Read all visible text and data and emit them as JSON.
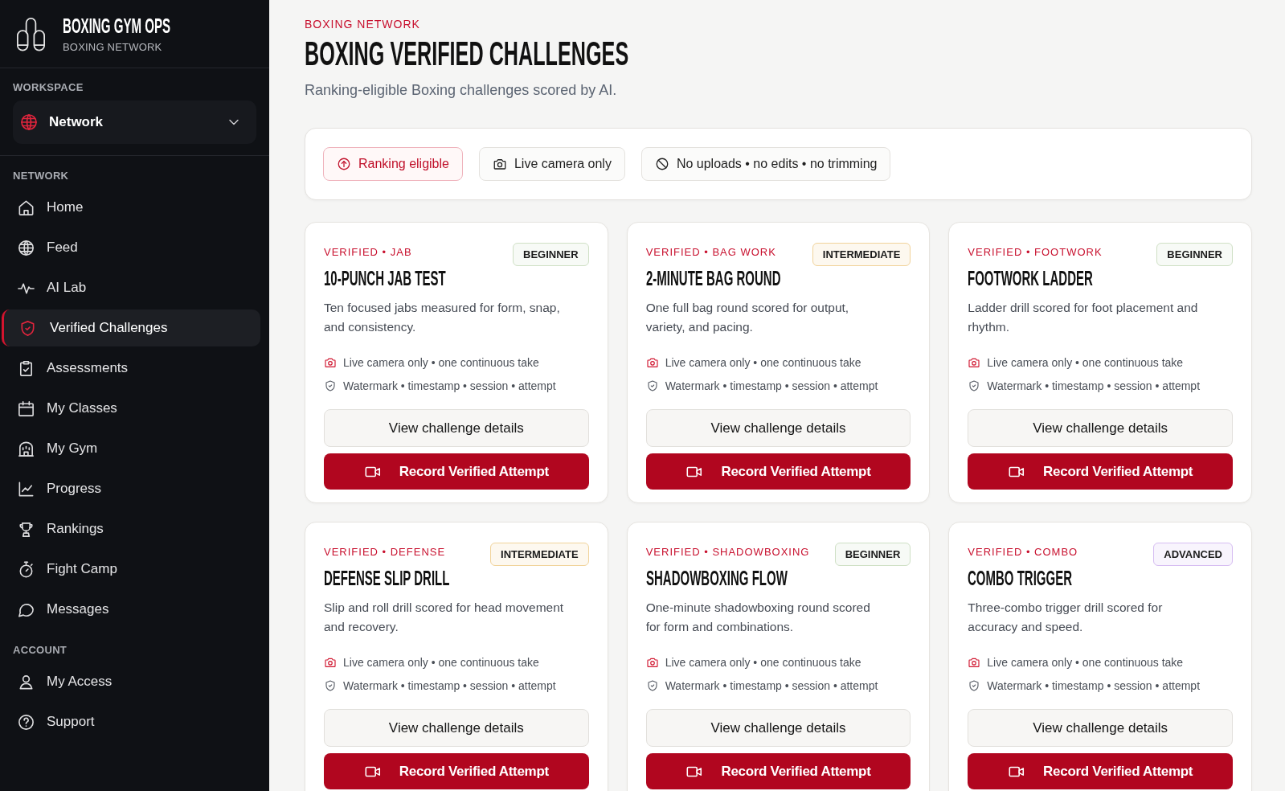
{
  "sidebar": {
    "brand": {
      "title": "BOXING GYM OPS",
      "subtitle": "BOXING NETWORK"
    },
    "workspace": {
      "label": "WORKSPACE",
      "value": "Network"
    },
    "sections": [
      {
        "label": "NETWORK",
        "items": [
          {
            "label": "Home",
            "selected": false
          },
          {
            "label": "Feed",
            "selected": false
          },
          {
            "label": "AI Lab",
            "selected": false
          },
          {
            "label": "Verified Challenges",
            "selected": true
          },
          {
            "label": "Assessments",
            "selected": false
          },
          {
            "label": "My Classes",
            "selected": false
          },
          {
            "label": "My Gym",
            "selected": false
          },
          {
            "label": "Progress",
            "selected": false
          },
          {
            "label": "Rankings",
            "selected": false
          },
          {
            "label": "Fight Camp",
            "selected": false
          },
          {
            "label": "Messages",
            "selected": false
          }
        ]
      },
      {
        "label": "ACCOUNT",
        "items": [
          {
            "label": "My Access",
            "selected": false
          },
          {
            "label": "Support",
            "selected": false
          }
        ]
      }
    ]
  },
  "header": {
    "eyebrow": "BOXING NETWORK",
    "title": "BOXING VERIFIED CHALLENGES",
    "subtitle": "Ranking-eligible Boxing challenges scored by AI."
  },
  "rules": [
    {
      "kind": "accent",
      "label": "Ranking eligible"
    },
    {
      "kind": "plain",
      "label": "Live camera only"
    },
    {
      "kind": "plain",
      "label": "No uploads • no edits • no trimming"
    }
  ],
  "cards": [
    {
      "category": "VERIFIED • JAB",
      "badge": {
        "label": "BEGINNER",
        "color": "#cfe0c5"
      },
      "title": "10-PUNCH JAB TEST",
      "description": "Ten focused jabs measured for form, snap, and consistency.",
      "requirements": [
        {
          "kind": "capture",
          "text": "Live camera only • one continuous take"
        },
        {
          "kind": "integrity",
          "text": "Watermark • timestamp • session • attempt"
        }
      ],
      "details_button": "View challenge details",
      "record_button": "Record Verified Attempt"
    },
    {
      "category": "VERIFIED • BAG WORK",
      "badge": {
        "label": "INTERMEDIATE",
        "color": "#f1d39a"
      },
      "title": "2-MINUTE BAG ROUND",
      "description": "One full bag round scored for output, variety, and pacing.",
      "requirements": [
        {
          "kind": "capture",
          "text": "Live camera only • one continuous take"
        },
        {
          "kind": "integrity",
          "text": "Watermark • timestamp • session • attempt"
        }
      ],
      "details_button": "View challenge details",
      "record_button": "Record Verified Attempt"
    },
    {
      "category": "VERIFIED • FOOTWORK",
      "badge": {
        "label": "BEGINNER",
        "color": "#cfe0c5"
      },
      "title": "FOOTWORK LADDER",
      "description": "Ladder drill scored for foot placement and rhythm.",
      "requirements": [
        {
          "kind": "capture",
          "text": "Live camera only • one continuous take"
        },
        {
          "kind": "integrity",
          "text": "Watermark • timestamp • session • attempt"
        }
      ],
      "details_button": "View challenge details",
      "record_button": "Record Verified Attempt"
    },
    {
      "category": "VERIFIED • DEFENSE",
      "badge": {
        "label": "INTERMEDIATE",
        "color": "#f1d39a"
      },
      "title": "DEFENSE SLIP DRILL",
      "description": "Slip and roll drill scored for head movement and recovery.",
      "requirements": [
        {
          "kind": "capture",
          "text": "Live camera only • one continuous take"
        },
        {
          "kind": "integrity",
          "text": "Watermark • timestamp • session • attempt"
        }
      ],
      "details_button": "View challenge details",
      "record_button": "Record Verified Attempt"
    },
    {
      "category": "VERIFIED • SHADOWBOXING",
      "badge": {
        "label": "BEGINNER",
        "color": "#cfe0c5"
      },
      "title": "SHADOWBOXING FLOW",
      "description": "One-minute shadowboxing round scored for form and combinations.",
      "requirements": [
        {
          "kind": "capture",
          "text": "Live camera only • one continuous take"
        },
        {
          "kind": "integrity",
          "text": "Watermark • timestamp • session • attempt"
        }
      ],
      "details_button": "View challenge details",
      "record_button": "Record Verified Attempt"
    },
    {
      "category": "VERIFIED • COMBO",
      "badge": {
        "label": "ADVANCED",
        "color": "#d6bdf2"
      },
      "title": "COMBO TRIGGER",
      "description": "Three-combo trigger drill scored for accuracy and speed.",
      "requirements": [
        {
          "kind": "capture",
          "text": "Live camera only • one continuous take"
        },
        {
          "kind": "integrity",
          "text": "Watermark • timestamp • session • attempt"
        }
      ],
      "details_button": "View challenge details",
      "record_button": "Record Verified Attempt"
    }
  ]
}
